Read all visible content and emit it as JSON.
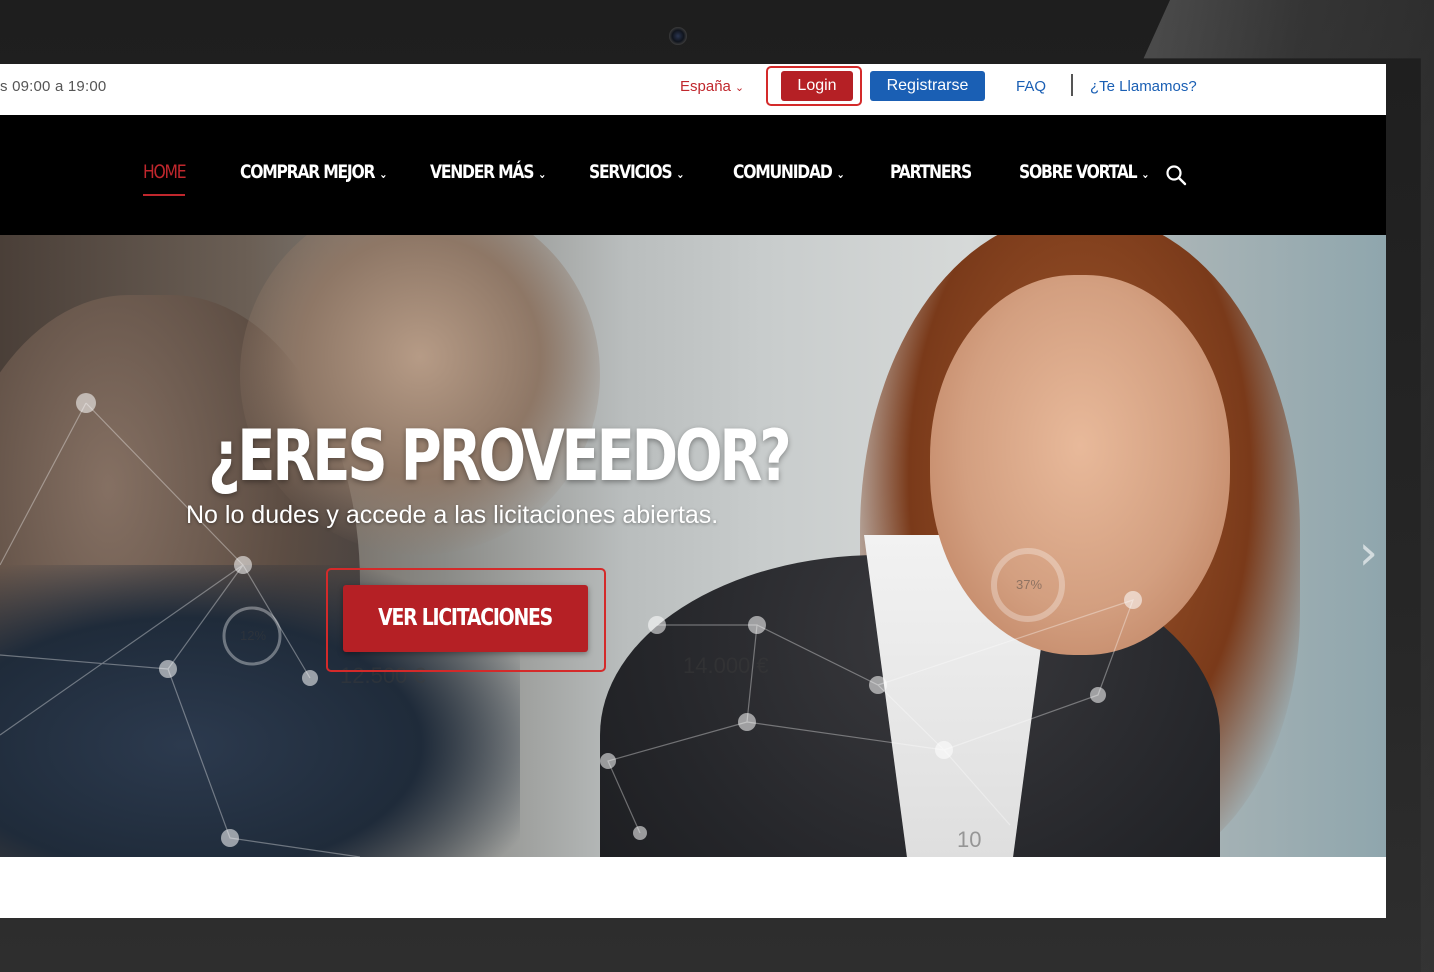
{
  "topbar": {
    "hours_text": "s 09:00 a 19:00",
    "country_label": "España",
    "login_label": "Login",
    "register_label": "Registrarse",
    "faq_label": "FAQ",
    "callme_label": "¿Te Llamamos?"
  },
  "nav": {
    "items": [
      {
        "label": "HOME",
        "active": true,
        "has_dropdown": false
      },
      {
        "label": "COMPRAR MEJOR",
        "active": false,
        "has_dropdown": true
      },
      {
        "label": "VENDER MÁS",
        "active": false,
        "has_dropdown": true
      },
      {
        "label": "SERVICIOS",
        "active": false,
        "has_dropdown": true
      },
      {
        "label": "COMUNIDAD",
        "active": false,
        "has_dropdown": true
      },
      {
        "label": "PARTNERS",
        "active": false,
        "has_dropdown": false
      },
      {
        "label": "SOBRE VORTAL",
        "active": false,
        "has_dropdown": true
      }
    ]
  },
  "hero": {
    "title": "¿ERES PROVEEDOR?",
    "subtitle": "No lo dudes y accede a las licitaciones abiertas.",
    "cta_label": "VER LICITACIONES",
    "overlay_numbers": [
      "12%",
      "12.500 €",
      "14.000 €",
      "37%",
      "10"
    ]
  },
  "colors": {
    "brand_red": "#b52025",
    "brand_blue": "#1a5fb4",
    "nav_bg": "#000000"
  },
  "icons": [
    "chevron-down-icon",
    "search-icon",
    "chevron-right-icon",
    "camera-icon"
  ]
}
